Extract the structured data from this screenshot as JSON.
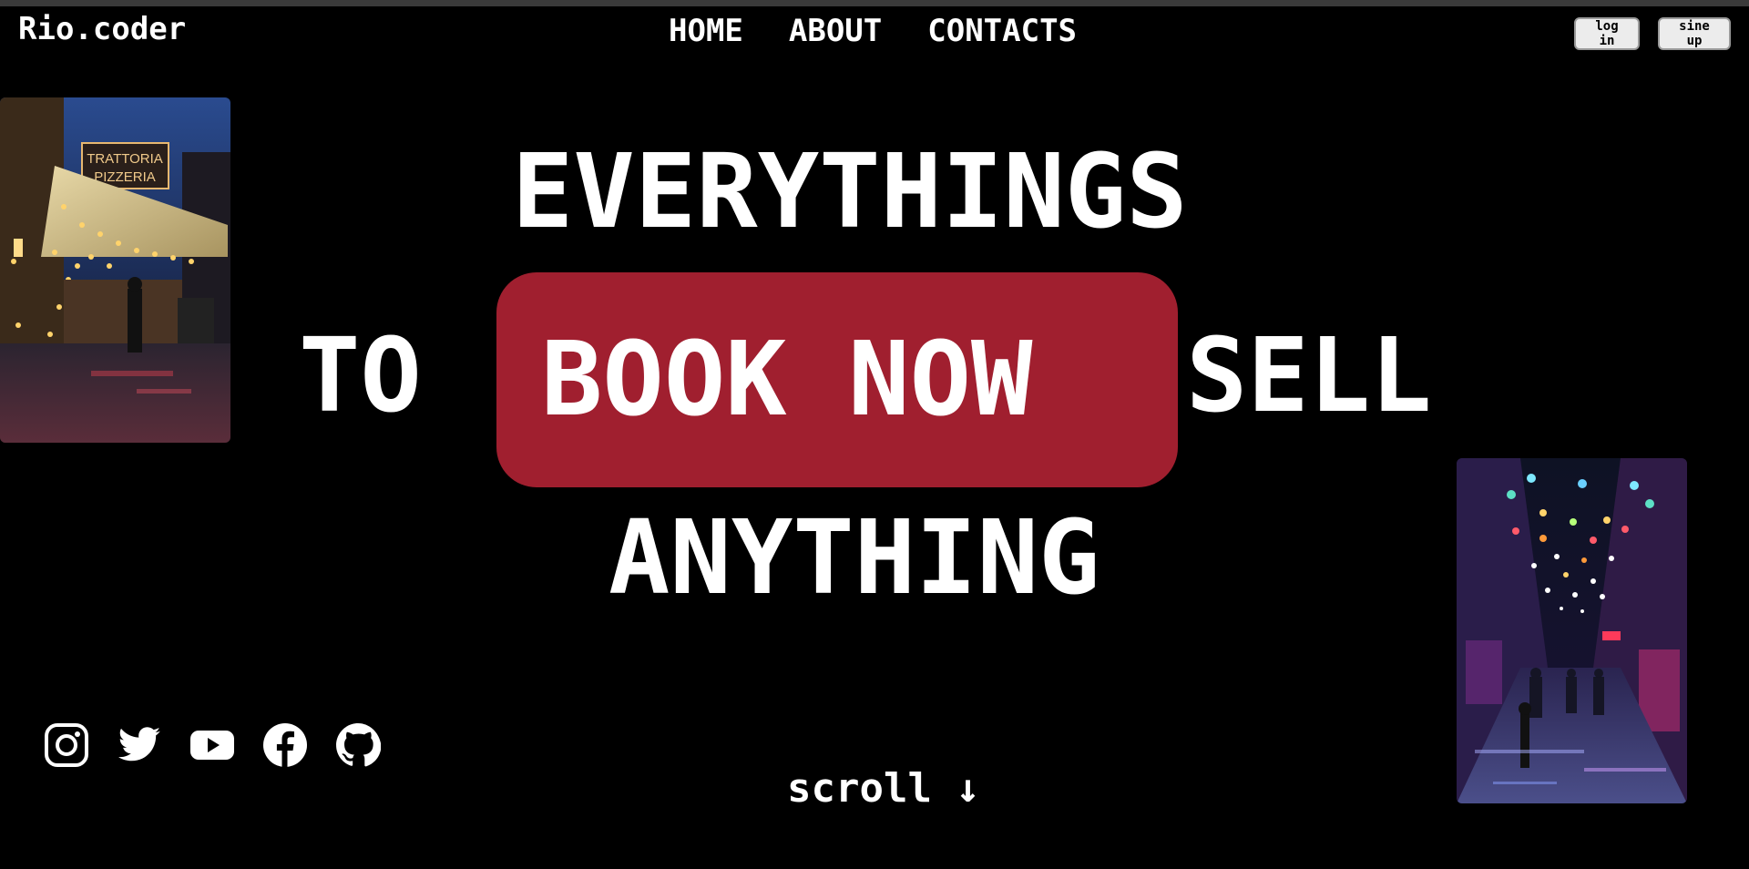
{
  "brand": {
    "logo": "Rio.coder"
  },
  "nav": {
    "home": "HOME",
    "about": "ABOUT",
    "contacts": "CONTACTS"
  },
  "auth": {
    "login": "log in",
    "signup": "sine up"
  },
  "hero": {
    "line1": "EVERYTHINGS",
    "line2_left": "TO",
    "cta": "BOOK NOW",
    "line2_right": "SELL",
    "line3": "ANYTHING"
  },
  "scroll": {
    "label": "scroll ↓"
  },
  "images": {
    "left_sign_line1": "TRATTORIA",
    "left_sign_line2": "PIZZERIA"
  },
  "social_icons": [
    "instagram-icon",
    "twitter-icon",
    "youtube-icon",
    "facebook-icon",
    "github-icon"
  ],
  "colors": {
    "background": "#000000",
    "accent": "#a01f2f",
    "text": "#ffffff"
  }
}
